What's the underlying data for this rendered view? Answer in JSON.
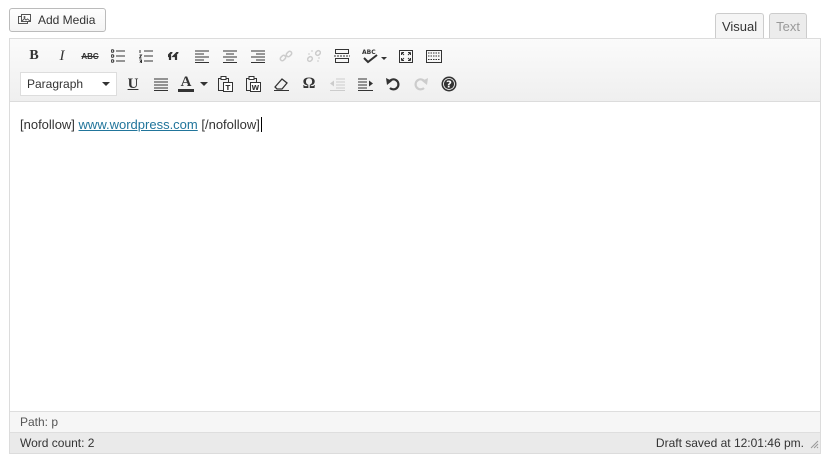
{
  "add_media": {
    "label": "Add Media",
    "icon": "media-icon"
  },
  "tabs": [
    {
      "label": "Visual",
      "active": true
    },
    {
      "label": "Text",
      "active": false
    }
  ],
  "toolbar": {
    "bold_glyph": "B",
    "italic_glyph": "I",
    "strike_glyph": "ABC",
    "underline_glyph": "U",
    "text_color_glyph": "A",
    "special_char_glyph": "Ω",
    "format_select_value": "Paragraph"
  },
  "content": {
    "before": "[nofollow] ",
    "link_text": "www.wordpress.com",
    "after": " [/nofollow]"
  },
  "path": "Path: p",
  "word_count": "Word count: 2",
  "draft_status": "Draft saved at 12:01:46 pm.",
  "colors": {
    "link": "#21759b",
    "text_color_bar": "#333333"
  }
}
